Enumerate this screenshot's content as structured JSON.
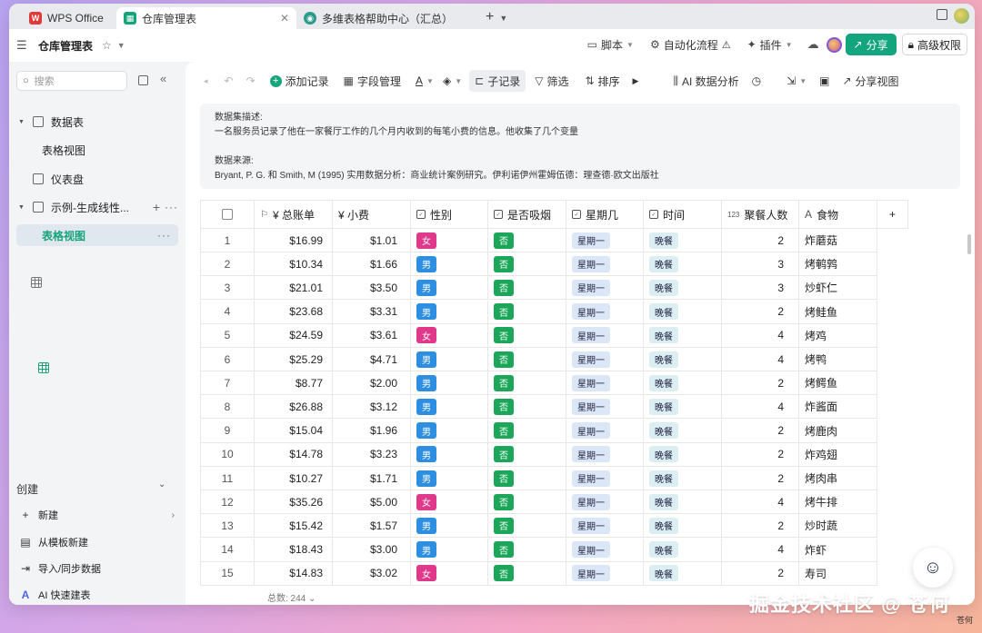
{
  "tabs": [
    {
      "label": "WPS Office",
      "icon": "wps-logo-icon",
      "color": "#e03a3a"
    },
    {
      "label": "仓库管理表",
      "icon": "sheet-icon",
      "color": "#15a37a",
      "active": true
    },
    {
      "label": "多维表格帮助中心（汇总）",
      "icon": "globe-icon",
      "color": "#2a9a8a"
    }
  ],
  "header": {
    "title": "仓库管理表",
    "items": [
      {
        "label": "脚本",
        "icon": "script-icon"
      },
      {
        "label": "自动化流程",
        "icon": "robot-icon"
      },
      {
        "label": "插件",
        "icon": "plugin-icon"
      }
    ],
    "share": "分享",
    "permission": "高级权限"
  },
  "sidebar": {
    "search_placeholder": "搜索",
    "nav": [
      {
        "label": "数据表",
        "icon": "table-icon",
        "expand": true
      },
      {
        "label": "表格视图",
        "icon": "grid-view-icon",
        "indent": true
      },
      {
        "label": "仪表盘",
        "icon": "dashboard-icon"
      },
      {
        "label": "示例-生成线性...",
        "icon": "table-icon",
        "expand": true
      },
      {
        "label": "表格视图",
        "icon": "grid-view-icon",
        "indent": true,
        "active": true
      }
    ],
    "create_header": "创建",
    "create_items": [
      {
        "label": "新建",
        "icon": "plus-icon"
      },
      {
        "label": "从模板新建",
        "icon": "template-icon"
      },
      {
        "label": "导入/同步数据",
        "icon": "import-icon"
      },
      {
        "label": "AI 快速建表",
        "icon": "ai-icon"
      }
    ]
  },
  "toolbar": {
    "add_record": "添加记录",
    "field_manage": "字段管理",
    "sub_record": "子记录",
    "filter": "筛选",
    "sort": "排序",
    "ai_analysis": "AI 数据分析",
    "share_view": "分享视图"
  },
  "description": {
    "label1": "数据集描述:",
    "text1": "一名服务员记录了他在一家餐厅工作的几个月内收到的每笔小费的信息。他收集了几个变量",
    "label2": "数据来源:",
    "text2": "Bryant, P. G. 和 Smith, M (1995) 实用数据分析：商业统计案例研究。伊利诺伊州霍姆伍德：理查德·欧文出版社"
  },
  "table": {
    "columns": [
      "¥ 总账单",
      "¥ 小费",
      "性别",
      "是否吸烟",
      "星期几",
      "时间",
      "聚餐人数",
      "食物"
    ],
    "rows": [
      {
        "n": "1",
        "bill": "$16.99",
        "tip": "$1.01",
        "sex": "女",
        "smoker": "否",
        "day": "星期一",
        "time": "晚餐",
        "size": "2",
        "food": "炸蘑菇"
      },
      {
        "n": "2",
        "bill": "$10.34",
        "tip": "$1.66",
        "sex": "男",
        "smoker": "否",
        "day": "星期一",
        "time": "晚餐",
        "size": "3",
        "food": "烤鹌鹑"
      },
      {
        "n": "3",
        "bill": "$21.01",
        "tip": "$3.50",
        "sex": "男",
        "smoker": "否",
        "day": "星期一",
        "time": "晚餐",
        "size": "3",
        "food": "炒虾仁"
      },
      {
        "n": "4",
        "bill": "$23.68",
        "tip": "$3.31",
        "sex": "男",
        "smoker": "否",
        "day": "星期一",
        "time": "晚餐",
        "size": "2",
        "food": "烤鲑鱼"
      },
      {
        "n": "5",
        "bill": "$24.59",
        "tip": "$3.61",
        "sex": "女",
        "smoker": "否",
        "day": "星期一",
        "time": "晚餐",
        "size": "4",
        "food": "烤鸡"
      },
      {
        "n": "6",
        "bill": "$25.29",
        "tip": "$4.71",
        "sex": "男",
        "smoker": "否",
        "day": "星期一",
        "time": "晚餐",
        "size": "4",
        "food": "烤鸭"
      },
      {
        "n": "7",
        "bill": "$8.77",
        "tip": "$2.00",
        "sex": "男",
        "smoker": "否",
        "day": "星期一",
        "time": "晚餐",
        "size": "2",
        "food": "烤鳄鱼"
      },
      {
        "n": "8",
        "bill": "$26.88",
        "tip": "$3.12",
        "sex": "男",
        "smoker": "否",
        "day": "星期一",
        "time": "晚餐",
        "size": "4",
        "food": "炸酱面"
      },
      {
        "n": "9",
        "bill": "$15.04",
        "tip": "$1.96",
        "sex": "男",
        "smoker": "否",
        "day": "星期一",
        "time": "晚餐",
        "size": "2",
        "food": "烤鹿肉"
      },
      {
        "n": "10",
        "bill": "$14.78",
        "tip": "$3.23",
        "sex": "男",
        "smoker": "否",
        "day": "星期一",
        "time": "晚餐",
        "size": "2",
        "food": "炸鸡翅"
      },
      {
        "n": "11",
        "bill": "$10.27",
        "tip": "$1.71",
        "sex": "男",
        "smoker": "否",
        "day": "星期一",
        "time": "晚餐",
        "size": "2",
        "food": "烤肉串"
      },
      {
        "n": "12",
        "bill": "$35.26",
        "tip": "$5.00",
        "sex": "女",
        "smoker": "否",
        "day": "星期一",
        "time": "晚餐",
        "size": "4",
        "food": "烤牛排"
      },
      {
        "n": "13",
        "bill": "$15.42",
        "tip": "$1.57",
        "sex": "男",
        "smoker": "否",
        "day": "星期一",
        "time": "晚餐",
        "size": "2",
        "food": "炒时蔬"
      },
      {
        "n": "14",
        "bill": "$18.43",
        "tip": "$3.00",
        "sex": "男",
        "smoker": "否",
        "day": "星期一",
        "time": "晚餐",
        "size": "4",
        "food": "炸虾"
      },
      {
        "n": "15",
        "bill": "$14.83",
        "tip": "$3.02",
        "sex": "女",
        "smoker": "否",
        "day": "星期一",
        "time": "晚餐",
        "size": "2",
        "food": "寿司"
      }
    ],
    "total_label": "总数: 244"
  },
  "watermark": "掘金技术社区 @ 苍何",
  "watermark_small": "苍何"
}
